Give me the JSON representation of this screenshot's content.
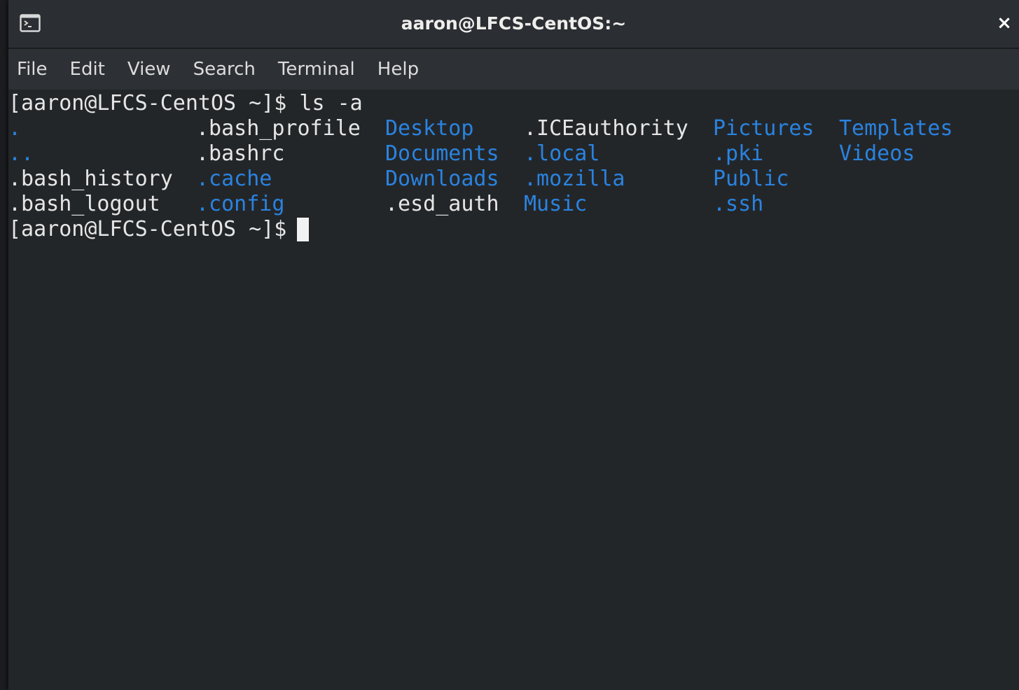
{
  "window": {
    "title": "aaron@LFCS-CentOS:~",
    "close_glyph": "×",
    "icon": "terminal-icon"
  },
  "menu": [
    "File",
    "Edit",
    "View",
    "Search",
    "Terminal",
    "Help"
  ],
  "terminal": {
    "prompt": "[aaron@LFCS-CentOS ~]$ ",
    "command": "ls -a",
    "listing_rows": [
      [
        {
          "name": ".",
          "type": "dir"
        },
        {
          "name": ".bash_profile",
          "type": "file"
        },
        {
          "name": "Desktop",
          "type": "dir"
        },
        {
          "name": ".ICEauthority",
          "type": "file"
        },
        {
          "name": "Pictures",
          "type": "dir"
        },
        {
          "name": "Templates",
          "type": "dir"
        }
      ],
      [
        {
          "name": "..",
          "type": "dir"
        },
        {
          "name": ".bashrc",
          "type": "file"
        },
        {
          "name": "Documents",
          "type": "dir"
        },
        {
          "name": ".local",
          "type": "dir"
        },
        {
          "name": ".pki",
          "type": "dir"
        },
        {
          "name": "Videos",
          "type": "dir"
        }
      ],
      [
        {
          "name": ".bash_history",
          "type": "file"
        },
        {
          "name": ".cache",
          "type": "dir"
        },
        {
          "name": "Downloads",
          "type": "dir"
        },
        {
          "name": ".mozilla",
          "type": "dir"
        },
        {
          "name": "Public",
          "type": "dir"
        }
      ],
      [
        {
          "name": ".bash_logout",
          "type": "file"
        },
        {
          "name": ".config",
          "type": "dir"
        },
        {
          "name": ".esd_auth",
          "type": "file"
        },
        {
          "name": "Music",
          "type": "dir"
        },
        {
          "name": ".ssh",
          "type": "dir"
        }
      ]
    ]
  },
  "colors": {
    "directory": "#2a83e0",
    "text": "#e6e6e6",
    "background": "#232629"
  }
}
